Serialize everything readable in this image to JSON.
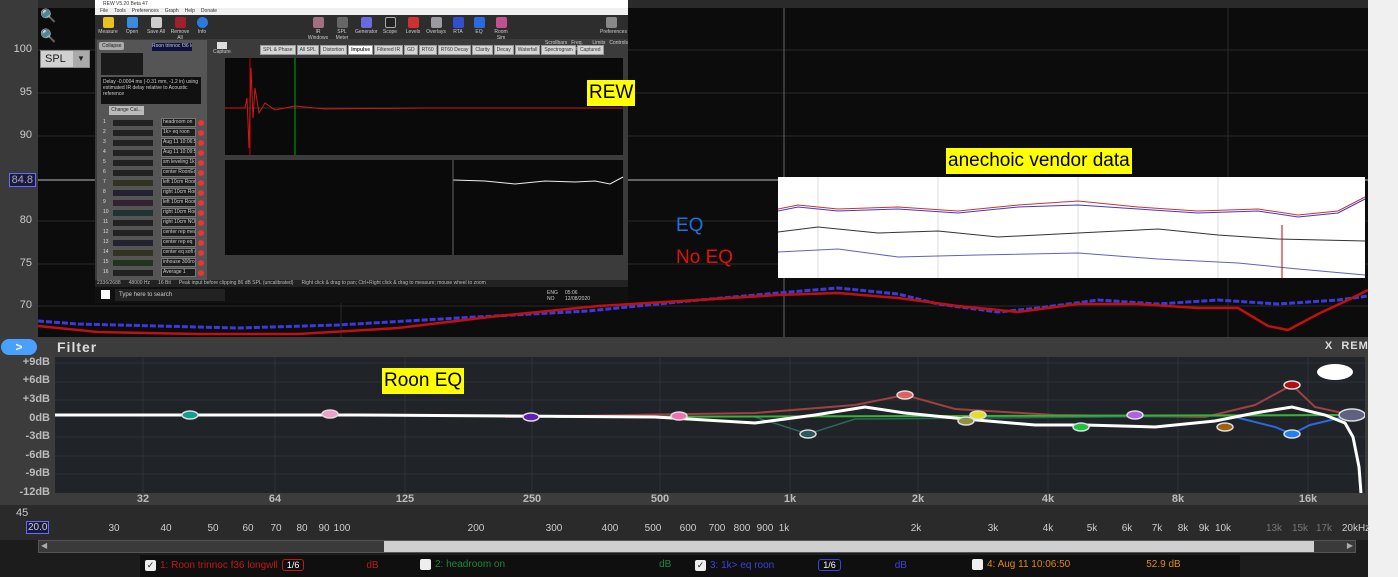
{
  "main_graph": {
    "y_axis_labels": [
      "100",
      "95",
      "90",
      "80",
      "75",
      "70",
      "45"
    ],
    "cursor_value": "84.8",
    "y_top_hidden_label": "45",
    "display_select": "SPL",
    "x_start_value": "20.0",
    "x_axis_labels": [
      "30",
      "40",
      "50",
      "60",
      "70",
      "80",
      "90",
      "100",
      "200",
      "300",
      "400",
      "500",
      "600",
      "700",
      "800",
      "900",
      "1k",
      "2k",
      "3k",
      "4k",
      "5k",
      "6k",
      "7k",
      "8k",
      "9k",
      "10k",
      "13k",
      "15k",
      "17k",
      "20kHz"
    ],
    "annotations": {
      "rew": "REW",
      "vendor": "anechoic vendor data",
      "eq": "EQ",
      "no_eq": "No EQ",
      "roon_eq": "Roon EQ"
    },
    "colors": {
      "eq": "#3a3adf",
      "no_eq": "#c01010",
      "annotation_bg": "#ffff00"
    }
  },
  "legend": [
    {
      "checked": true,
      "label": "1: Roon trinnoc f36 longwll",
      "smoothing": "1/6",
      "unit": "dB",
      "color": "#c01818"
    },
    {
      "checked": false,
      "label": "2: headroom on",
      "unit": "dB",
      "color": "#1a8a3a"
    },
    {
      "checked": true,
      "label": "3: 1k> eq roon",
      "smoothing": "1/6",
      "unit": "dB",
      "color": "#4040e0"
    },
    {
      "checked": false,
      "label": "4: Aug 11 10:06:50",
      "unit": "52.9 dB",
      "color": "#e08a1a"
    }
  ],
  "rew_window": {
    "title": "REW V5.20 Beta 47",
    "menu": [
      "File",
      "Tools",
      "Preferences",
      "Graph",
      "Help",
      "Donate"
    ],
    "toolbar_left": [
      "Measure",
      "Open",
      "Save All",
      "Remove All",
      "Info"
    ],
    "toolbar_center": [
      "IR Windows",
      "SPL Meter",
      "Generator",
      "Scope",
      "Levels",
      "Overlays",
      "RTA",
      "EQ",
      "Room Sim"
    ],
    "toolbar_right": "Preferences",
    "collapse": "Collapse",
    "selected_measurement": "Roon trinnoc f36 longwll",
    "info_text": "Delay -0.0004 ms (-0.31 mm, -1.2 in) using estimated IR delay relative to Acoustic reference",
    "change_cal": "Change Cal...",
    "capture": "Capture",
    "tabs": [
      "SPL & Phase",
      "All SPL",
      "Distortion",
      "Impulse",
      "Filtered IR",
      "GD",
      "RT60",
      "RT60 Decay",
      "Clarity",
      "Decay",
      "Waterfall",
      "Spectrogram",
      "Captured"
    ],
    "active_tab": "Impulse",
    "right_controls": [
      "Scrollbars",
      "Freq. Axis",
      "Limits",
      "Controls"
    ],
    "measurements": [
      {
        "n": "1",
        "name": "headroom on"
      },
      {
        "n": "2",
        "name": "1k> eq roon"
      },
      {
        "n": "3",
        "name": "Aug 11 10:06:50"
      },
      {
        "n": "4",
        "name": "Aug 11 10:09:55"
      },
      {
        "n": "5",
        "name": "sm leveling 1k"
      },
      {
        "n": "6",
        "name": "center RoonEq 1k"
      },
      {
        "n": "7",
        "name": "left 10cm RoonEq 1kh"
      },
      {
        "n": "8",
        "name": "right 10cm RoonEq 1kh"
      },
      {
        "n": "9",
        "name": "left 10cm RoonEq 1kh"
      },
      {
        "n": "10",
        "name": "right 10cm RoonEq 1kh"
      },
      {
        "n": "11",
        "name": "right 10cm NO roon EQ"
      },
      {
        "n": "12",
        "name": "center rep meas"
      },
      {
        "n": "13",
        "name": "center rep eq"
      },
      {
        "n": "14",
        "name": "center eq sofi down"
      },
      {
        "n": "15",
        "name": "inhouse 300roon"
      },
      {
        "n": "16",
        "name": "Average 1"
      }
    ],
    "status": [
      "2336/2688",
      "48000 Hz",
      "16 Bit",
      "Peak input before clipping 86 dB SPL (uncalibrated)",
      "Right click & drag to pan; Ctrl+Right click & drag to measure; mouse wheel to zoom"
    ],
    "taskbar": {
      "search": "Type here to search",
      "lang": "ENG",
      "region": "NO",
      "time": "05:06",
      "date": "12/08/2020"
    }
  },
  "filter_panel": {
    "title": "Filter",
    "expand": ">",
    "close": "X",
    "remove": "REMOVE",
    "y_labels": [
      "+9dB",
      "+6dB",
      "+3dB",
      "0dB",
      "-3dB",
      "-6dB",
      "-9dB",
      "-12dB"
    ],
    "x_labels": [
      "32",
      "64",
      "125",
      "250",
      "500",
      "1k",
      "2k",
      "4k",
      "8k",
      "16k"
    ]
  }
}
